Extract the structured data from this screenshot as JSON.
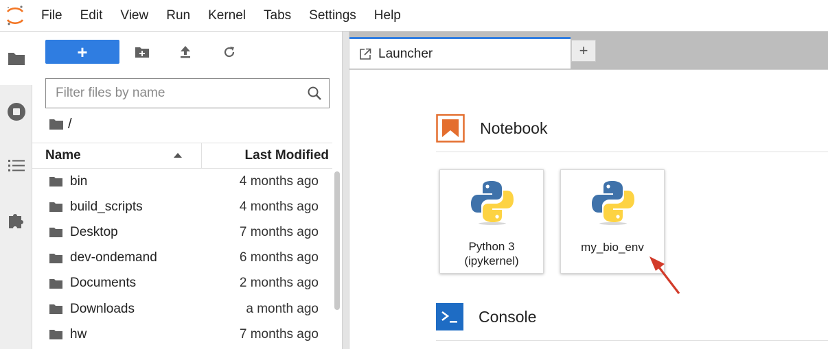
{
  "menubar": {
    "items": [
      "File",
      "Edit",
      "View",
      "Run",
      "Kernel",
      "Tabs",
      "Settings",
      "Help"
    ]
  },
  "activitybar": {
    "icons": [
      "folder-icon",
      "stop-circle-icon",
      "list-icon",
      "puzzle-icon"
    ]
  },
  "filebrowser": {
    "new_label": "+",
    "filter_placeholder": "Filter files by name",
    "breadcrumb": "/",
    "columns": {
      "name": "Name",
      "modified": "Last Modified"
    },
    "files": [
      {
        "name": "bin",
        "modified": "4 months ago"
      },
      {
        "name": "build_scripts",
        "modified": "4 months ago"
      },
      {
        "name": "Desktop",
        "modified": "7 months ago"
      },
      {
        "name": "dev-ondemand",
        "modified": "6 months ago"
      },
      {
        "name": "Documents",
        "modified": "2 months ago"
      },
      {
        "name": "Downloads",
        "modified": "a month ago"
      },
      {
        "name": "hw",
        "modified": "7 months ago"
      }
    ]
  },
  "tabs": {
    "active": "Launcher",
    "add_label": "+"
  },
  "launcher": {
    "notebook_section": "Notebook",
    "console_section": "Console",
    "kernels": [
      {
        "line1": "Python 3",
        "line2": "(ipykernel)"
      },
      {
        "line1": "my_bio_env",
        "line2": ""
      }
    ]
  },
  "colors": {
    "accent": "#2f7de1",
    "notebook_orange": "#e46e2e",
    "console_blue": "#1e6cc4",
    "annotation_red": "#d23b2a"
  }
}
